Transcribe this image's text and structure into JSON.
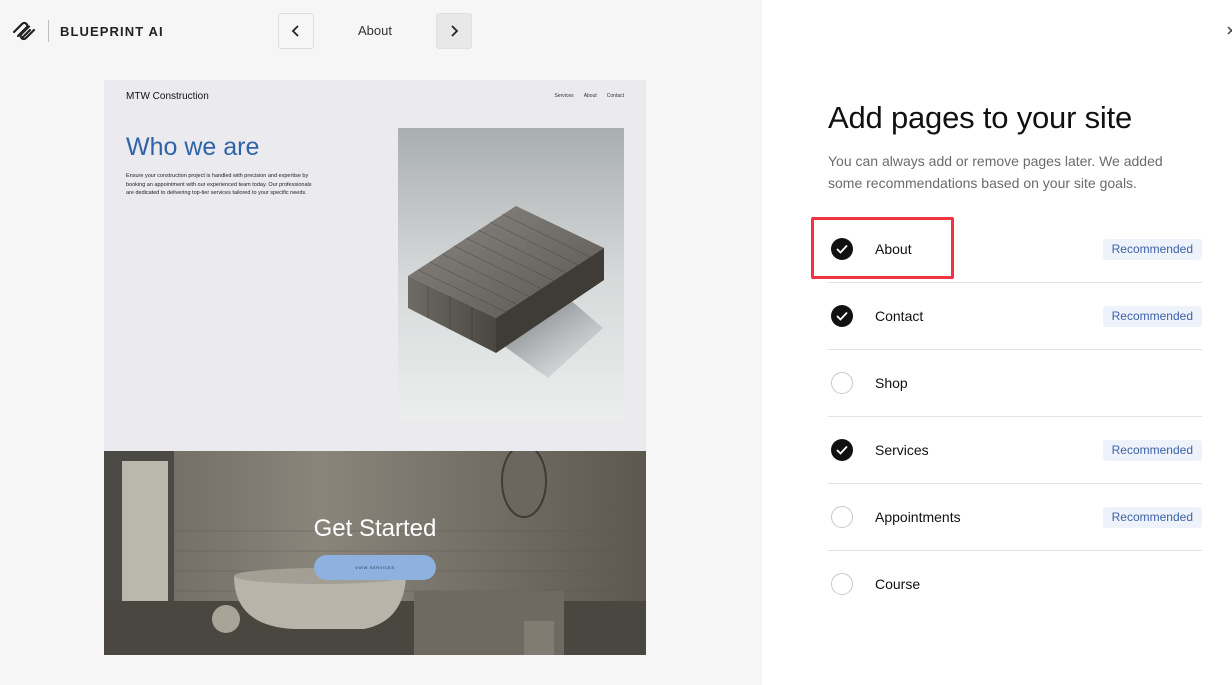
{
  "header": {
    "brand": "BLUEPRINT AI",
    "current_page": "About"
  },
  "preview": {
    "site_name": "MTW Construction",
    "nav": [
      "Services",
      "About",
      "Contact"
    ],
    "hero_title": "Who we are",
    "hero_text": "Ensure your construction project is handled with precision and expertise by booking an appointment with our experienced team today. Our professionals are dedicated to delivering top-tier services tailored to your specific needs.",
    "cta_title": "Get Started",
    "cta_button": "VIEW SERVICES"
  },
  "panel": {
    "title": "Add pages to your site",
    "subtitle": "You can always add or remove pages later. We added some recommendations based on your site goals.",
    "pages": [
      {
        "label": "About",
        "checked": true,
        "badge": "Recommended"
      },
      {
        "label": "Contact",
        "checked": true,
        "badge": "Recommended"
      },
      {
        "label": "Shop",
        "checked": false,
        "badge": ""
      },
      {
        "label": "Services",
        "checked": true,
        "badge": "Recommended"
      },
      {
        "label": "Appointments",
        "checked": false,
        "badge": "Recommended"
      },
      {
        "label": "Course",
        "checked": false,
        "badge": ""
      }
    ]
  },
  "colors": {
    "accent_blue": "#2f63a9",
    "badge_text": "#3c62a8",
    "highlight_red": "#ef3343"
  }
}
